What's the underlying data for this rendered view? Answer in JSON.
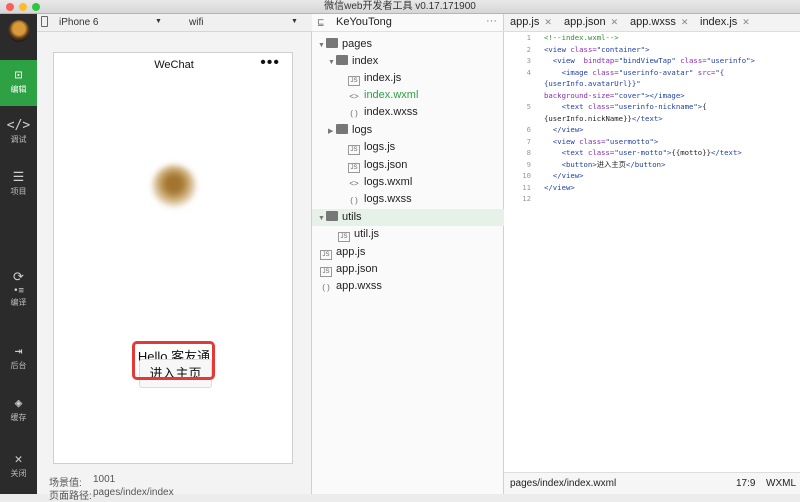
{
  "window": {
    "title": "微信web开发者工具 v0.17.171900"
  },
  "sidebar": {
    "items": [
      {
        "label": "编辑",
        "icon": "code-square-icon"
      },
      {
        "label": "调试",
        "icon": "debug-icon"
      },
      {
        "label": "项目",
        "icon": "menu-icon"
      },
      {
        "label": "编译",
        "icon": "compile-icon"
      },
      {
        "label": "后台",
        "icon": "background-icon"
      },
      {
        "label": "缓存",
        "icon": "layers-icon"
      },
      {
        "label": "关闭",
        "icon": "close-icon"
      }
    ]
  },
  "simulator": {
    "device": "iPhone 6",
    "network": "wifi",
    "phone_title": "WeChat",
    "phone_menu": "•••",
    "nickname": "Hello 客友通",
    "button_label": "进入主页",
    "scene_label": "场景值:",
    "scene_value": "1001",
    "path_label": "页面路径:",
    "path_value": "pages/index/index"
  },
  "filetree": {
    "project": "KeYouTong",
    "more": "···",
    "nodes": [
      {
        "label": "pages",
        "kind": "folder"
      },
      {
        "label": "index",
        "kind": "folder"
      },
      {
        "label": "index.js",
        "kind": "js"
      },
      {
        "label": "index.wxml",
        "kind": "wxml"
      },
      {
        "label": "index.wxss",
        "kind": "wxss"
      },
      {
        "label": "logs",
        "kind": "folder"
      },
      {
        "label": "logs.js",
        "kind": "js"
      },
      {
        "label": "logs.json",
        "kind": "json"
      },
      {
        "label": "logs.wxml",
        "kind": "wxml"
      },
      {
        "label": "logs.wxss",
        "kind": "wxss"
      },
      {
        "label": "utils",
        "kind": "folder"
      },
      {
        "label": "util.js",
        "kind": "js"
      },
      {
        "label": "app.js",
        "kind": "js"
      },
      {
        "label": "app.json",
        "kind": "json"
      },
      {
        "label": "app.wxss",
        "kind": "wxss"
      }
    ]
  },
  "editor": {
    "tabs": [
      "app.js",
      "app.json",
      "app.wxss",
      "index.js"
    ],
    "line_numbers": [
      "1",
      "2",
      "3",
      "4",
      "",
      "",
      "5",
      "",
      "6",
      "7",
      "8",
      "9",
      "10",
      "11",
      "12"
    ],
    "status_path": "pages/index/index.wxml",
    "status_pos": "17:9",
    "status_lang": "WXML"
  }
}
